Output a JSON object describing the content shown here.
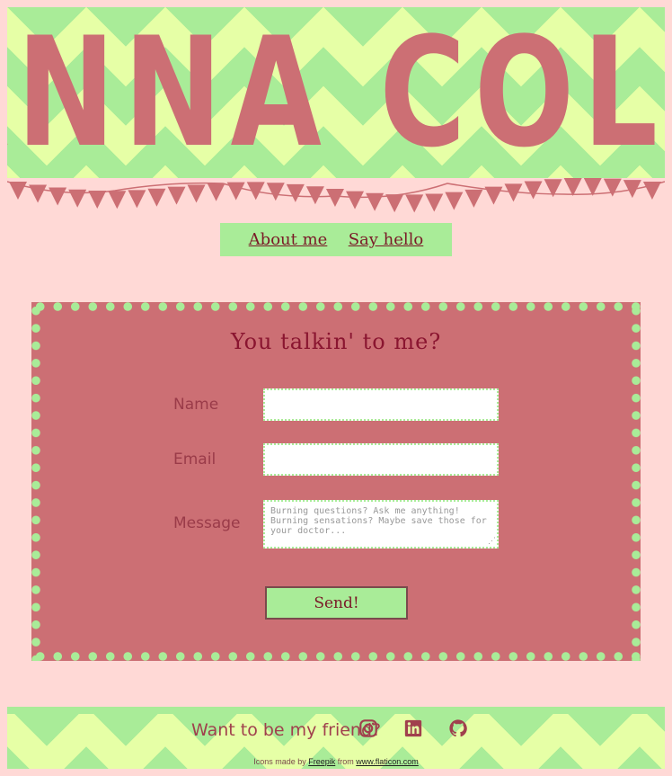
{
  "header": {
    "site_title": "ANNA COLE"
  },
  "nav": {
    "items": [
      {
        "label": "About me"
      },
      {
        "label": "Say hello"
      }
    ]
  },
  "contact_form": {
    "title": "You talkin' to me?",
    "name_label": "Name",
    "name_value": "",
    "email_label": "Email",
    "email_value": "",
    "message_label": "Message",
    "message_placeholder": "Burning questions? Ask me anything! Burning sensations? Maybe save those for your doctor...",
    "send_label": "Send!"
  },
  "footer": {
    "friend_text": "Want to be my friend?",
    "social_icons": [
      "instagram-icon",
      "linkedin-icon",
      "github-icon"
    ],
    "credits_prefix": "Icons made by",
    "credits_author": "Freepik",
    "credits_middle": "from",
    "credits_site": "www.flaticon.com"
  },
  "colors": {
    "background": "#ffd9d6",
    "accent_green": "#a9ec98",
    "pale_green": "#e6ffa6",
    "rose": "#cc6f74",
    "dark_red": "#7a1a28"
  }
}
